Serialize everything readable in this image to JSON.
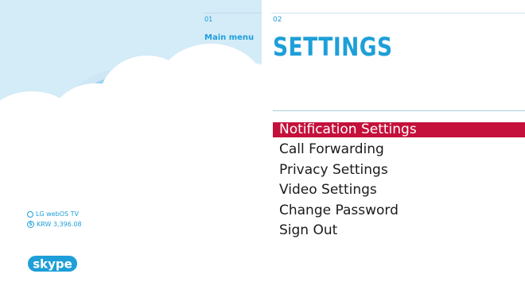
{
  "left": {
    "step_number": "01",
    "step_title": "Main menu",
    "account": {
      "tv_name": "LG webOS TV",
      "credit_symbol": "S",
      "credit": "KRW 3,396.08"
    },
    "logo_text": "skype"
  },
  "right": {
    "step_number": "02",
    "title": "SETTINGS",
    "menu": [
      {
        "label": "Notification Settings",
        "selected": true
      },
      {
        "label": "Call Forwarding"
      },
      {
        "label": "Privacy Settings"
      },
      {
        "label": "Video Settings"
      },
      {
        "label": "Change Password"
      },
      {
        "label": "Sign Out"
      }
    ]
  },
  "colors": {
    "accent": "#1e9fd8",
    "selection": "#c4103a",
    "sky": "#d4ebf8"
  },
  "icons": [
    "status-ring-icon",
    "skype-credit-icon",
    "skype-logo-icon"
  ]
}
